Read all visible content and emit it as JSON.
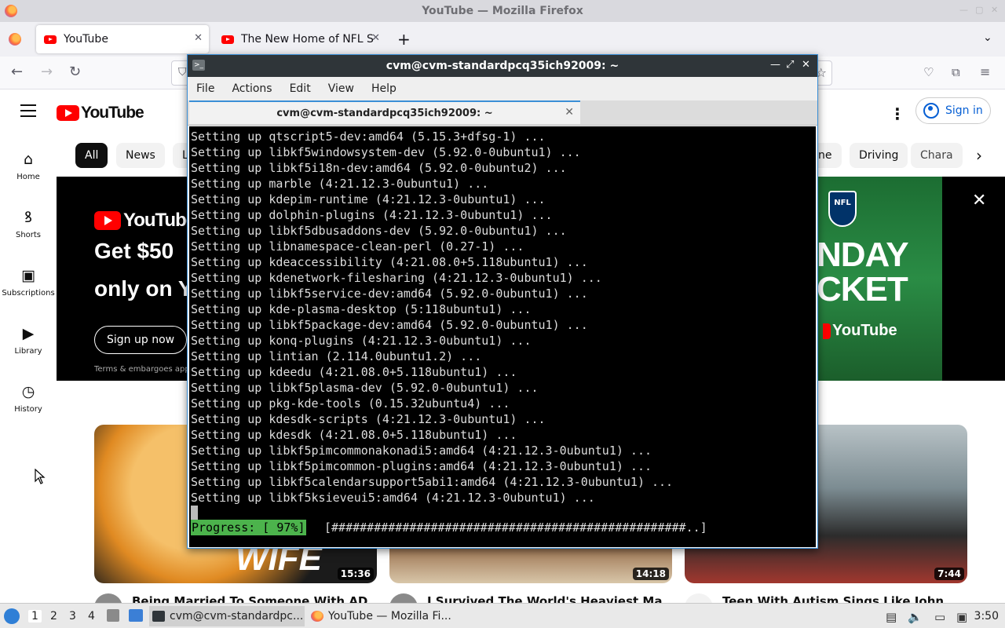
{
  "firefox": {
    "window_title": "YouTube — Mozilla Firefox",
    "tabs": [
      {
        "label": "YouTube",
        "active": true
      },
      {
        "label": "The New Home of NFL Su",
        "active": false
      }
    ],
    "new_tab_icon": "plus-icon",
    "list_tabs_icon": "chevron-down-icon",
    "nav": {
      "back_icon": "back-arrow-icon",
      "forward_icon": "forward-arrow-icon",
      "reload_icon": "reload-icon"
    }
  },
  "youtube": {
    "logo_text": "YouTube",
    "sign_in_label": "Sign in",
    "guide": [
      {
        "label": "Home",
        "icon": "home-icon"
      },
      {
        "label": "Shorts",
        "icon": "shorts-icon"
      },
      {
        "label": "Subscriptions",
        "icon": "subscriptions-icon"
      },
      {
        "label": "Library",
        "icon": "library-icon"
      },
      {
        "label": "History",
        "icon": "history-icon"
      }
    ],
    "chips": {
      "all": "All",
      "news": "News",
      "partial_left": "L",
      "partial_right": "ne",
      "driving": "Driving",
      "chara": "Chara"
    },
    "banner": {
      "logo_text": "YouTube",
      "headline_line1": "Get $50",
      "headline_line2": "only on Y",
      "cta_label": "Sign up now",
      "terms": "Terms & embargoes app",
      "nfl_text": "NFL",
      "big_text_line1": "NDAY",
      "big_text_line2": "CKET",
      "yt_mini_text": "YouTube"
    },
    "videos": [
      {
        "title": "Being Married To Someone With ADHD",
        "duration": "15:36",
        "thumb_text": "WIFE"
      },
      {
        "title": "I Survived The World's Heaviest Man's",
        "duration": "14:18"
      },
      {
        "title": "Teen With Autism Sings Like John",
        "duration": "7:44"
      }
    ]
  },
  "terminal": {
    "title": "cvm@cvm-standardpcq35ich92009: ~",
    "menu": [
      "File",
      "Actions",
      "Edit",
      "View",
      "Help"
    ],
    "tab_label": "cvm@cvm-standardpcq35ich92009: ~",
    "lines": [
      "Setting up qtscript5-dev:amd64 (5.15.3+dfsg-1) ...",
      "Setting up libkf5windowsystem-dev (5.92.0-0ubuntu1) ...",
      "Setting up libkf5i18n-dev:amd64 (5.92.0-0ubuntu2) ...",
      "Setting up marble (4:21.12.3-0ubuntu1) ...",
      "Setting up kdepim-runtime (4:21.12.3-0ubuntu1) ...",
      "Setting up dolphin-plugins (4:21.12.3-0ubuntu1) ...",
      "Setting up libkf5dbusaddons-dev (5.92.0-0ubuntu1) ...",
      "Setting up libnamespace-clean-perl (0.27-1) ...",
      "Setting up kdeaccessibility (4:21.08.0+5.118ubuntu1) ...",
      "Setting up kdenetwork-filesharing (4:21.12.3-0ubuntu1) ...",
      "Setting up libkf5service-dev:amd64 (5.92.0-0ubuntu1) ...",
      "Setting up kde-plasma-desktop (5:118ubuntu1) ...",
      "Setting up libkf5package-dev:amd64 (5.92.0-0ubuntu1) ...",
      "Setting up konq-plugins (4:21.12.3-0ubuntu1) ...",
      "Setting up lintian (2.114.0ubuntu1.2) ...",
      "Setting up kdeedu (4:21.08.0+5.118ubuntu1) ...",
      "Setting up libkf5plasma-dev (5.92.0-0ubuntu1) ...",
      "Setting up pkg-kde-tools (0.15.32ubuntu4) ...",
      "Setting up kdesdk-scripts (4:21.12.3-0ubuntu1) ...",
      "Setting up kdesdk (4:21.08.0+5.118ubuntu1) ...",
      "Setting up libkf5pimcommonakonadi5:amd64 (4:21.12.3-0ubuntu1) ...",
      "Setting up libkf5pimcommon-plugins:amd64 (4:21.12.3-0ubuntu1) ...",
      "Setting up libkf5calendarsupport5abi1:amd64 (4:21.12.3-0ubuntu1) ...",
      "Setting up libkf5ksieveui5:amd64 (4:21.12.3-0ubuntu1) ..."
    ],
    "progress_label": "Progress: [ 97%]",
    "progress_bar": "[##################################################..]",
    "progress_percent": 97,
    "progress_color": "#4cb34c"
  },
  "taskbar": {
    "workspaces": [
      "1",
      "2",
      "3",
      "4"
    ],
    "tasks": [
      {
        "label": "cvm@cvm-standardpc...",
        "icon": "terminal-icon"
      },
      {
        "label": "YouTube — Mozilla Fi...",
        "icon": "firefox-icon"
      }
    ],
    "clock": "3:50"
  },
  "colors": {
    "youtube_red": "#ff0000",
    "signin_blue": "#065fd4",
    "terminal_bg": "#000000",
    "accent_blue": "#3b8fd6"
  }
}
